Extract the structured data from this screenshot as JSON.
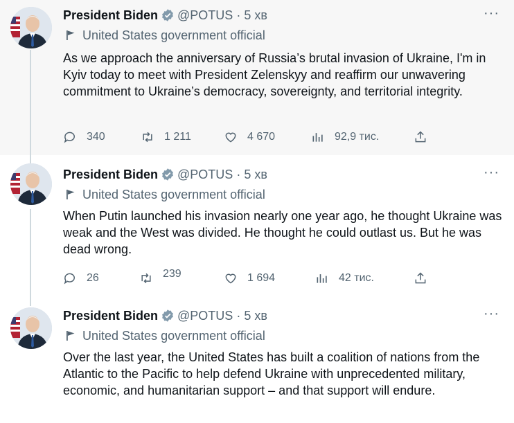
{
  "colors": {
    "verified": "#829aab",
    "text": "#0f1419",
    "secondary": "#536471",
    "line": "#cfd9de"
  },
  "tweets": [
    {
      "name": "President Biden",
      "handle": "@POTUS",
      "separator": "·",
      "time": "5 хв",
      "label": "United States government official",
      "text": "As we approach the anniversary of Russia’s brutal invasion of Ukraine, I'm in Kyiv today to meet with President Zelenskyy and reaffirm our unwavering commitment to Ukraine’s democracy, sovereignty, and territorial integrity.",
      "replies": "340",
      "retweets": "1 211",
      "likes": "4 670",
      "views": "92,9 тис."
    },
    {
      "name": "President Biden",
      "handle": "@POTUS",
      "separator": "·",
      "time": "5 хв",
      "label": "United States government official",
      "text": "When Putin launched his invasion nearly one year ago, he thought Ukraine was weak and the West was divided.  He thought he could outlast us. But he was dead wrong.",
      "replies": "26",
      "retweets": "239",
      "likes": "1 694",
      "views": "42 тис."
    },
    {
      "name": "President Biden",
      "handle": "@POTUS",
      "separator": "·",
      "time": "5 хв",
      "label": "United States government official",
      "text": "Over the last year, the United States has built a coalition of nations from the Atlantic to the Pacific to help defend Ukraine with unprecedented military, economic, and humanitarian support – and that support will endure."
    }
  ],
  "icons": {
    "verified": "verified-badge-icon",
    "more": "more-options-icon",
    "flag": "government-flag-icon",
    "reply": "reply-icon",
    "retweet": "retweet-icon",
    "like": "heart-icon",
    "views": "views-chart-icon",
    "share": "share-icon"
  }
}
